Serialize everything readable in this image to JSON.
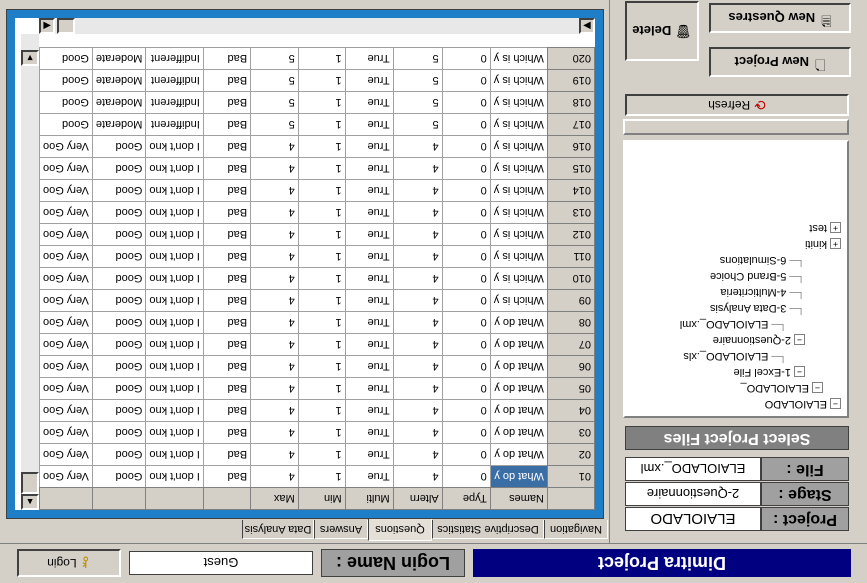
{
  "app_title": "Dimitra Project",
  "login": {
    "label": "Login Name :",
    "value": "Guest",
    "button": "Login"
  },
  "project_info": [
    {
      "label": "Project :",
      "value": "ELAIOLADO"
    },
    {
      "label": "Stage :",
      "value": "2-Questionnaire"
    },
    {
      "label": "File :",
      "value": "ELAIOLADO_.xml"
    }
  ],
  "toolbar": {
    "new_questres": "New Questres",
    "new_project": "New Project",
    "delete": "Delete",
    "refresh": "Refresh"
  },
  "select_files": "Select Project Files",
  "tree": [
    {
      "label": "ELAIOLADO",
      "toggle": "−",
      "level": 0
    },
    {
      "label": "ELAIOLADO_",
      "toggle": "−",
      "level": 1
    },
    {
      "label": "1-Excel File",
      "toggle": "−",
      "level": 2
    },
    {
      "label": "ELAIOLADO_.xls",
      "toggle": "",
      "level": 3
    },
    {
      "label": "2-Questionnaire",
      "toggle": "−",
      "level": 2
    },
    {
      "label": "ELAIOLADO_.xml",
      "toggle": "",
      "level": 3
    },
    {
      "label": "3-Data Analysis",
      "toggle": "",
      "level": 2
    },
    {
      "label": "4-Multicriteria",
      "toggle": "",
      "level": 2
    },
    {
      "label": "5-Brand Choice",
      "toggle": "",
      "level": 2
    },
    {
      "label": "6-Simulations",
      "toggle": "",
      "level": 2
    },
    {
      "label": "kiniti",
      "toggle": "+",
      "level": 0
    },
    {
      "label": "test",
      "toggle": "+",
      "level": 0
    }
  ],
  "tabs": [
    "Navigation",
    "Descriptive Statistics",
    "Questions",
    "Answers",
    "Data Analysis"
  ],
  "grid": {
    "columns": [
      "Names",
      "Type",
      "Altern",
      "Multi",
      "Min",
      "Max",
      "",
      "",
      "",
      ""
    ],
    "rows": [
      [
        "01",
        "What do y",
        "0",
        "4",
        "True",
        "1",
        "4",
        "Bad",
        "I don't kno",
        "Good",
        "Very Goo"
      ],
      [
        "02",
        "What do y",
        "0",
        "4",
        "True",
        "1",
        "4",
        "Bad",
        "I don't kno",
        "Good",
        "Very Goo"
      ],
      [
        "03",
        "What do y",
        "0",
        "4",
        "True",
        "1",
        "4",
        "Bad",
        "I don't kno",
        "Good",
        "Very Goo"
      ],
      [
        "04",
        "What do y",
        "0",
        "4",
        "True",
        "1",
        "4",
        "Bad",
        "I don't kno",
        "Good",
        "Very Goo"
      ],
      [
        "05",
        "What do y",
        "0",
        "4",
        "True",
        "1",
        "4",
        "Bad",
        "I don't kno",
        "Good",
        "Very Goo"
      ],
      [
        "06",
        "What do y",
        "0",
        "4",
        "True",
        "1",
        "4",
        "Bad",
        "I don't kno",
        "Good",
        "Very Goo"
      ],
      [
        "07",
        "What do y",
        "0",
        "4",
        "True",
        "1",
        "4",
        "Bad",
        "I don't kno",
        "Good",
        "Very Goo"
      ],
      [
        "08",
        "What do y",
        "0",
        "4",
        "True",
        "1",
        "4",
        "Bad",
        "I don't kno",
        "Good",
        "Very Goo"
      ],
      [
        "09",
        "Which is y",
        "0",
        "4",
        "True",
        "1",
        "4",
        "Bad",
        "I don't kno",
        "Good",
        "Very Goo"
      ],
      [
        "010",
        "Which is y",
        "0",
        "4",
        "True",
        "1",
        "4",
        "Bad",
        "I don't kno",
        "Good",
        "Very Goo"
      ],
      [
        "011",
        "Which is y",
        "0",
        "4",
        "True",
        "1",
        "4",
        "Bad",
        "I don't kno",
        "Good",
        "Very Goo"
      ],
      [
        "012",
        "Which is y",
        "0",
        "4",
        "True",
        "1",
        "4",
        "Bad",
        "I don't kno",
        "Good",
        "Very Goo"
      ],
      [
        "013",
        "Which is y",
        "0",
        "4",
        "True",
        "1",
        "4",
        "Bad",
        "I don't kno",
        "Good",
        "Very Goo"
      ],
      [
        "014",
        "Which is y",
        "0",
        "4",
        "True",
        "1",
        "4",
        "Bad",
        "I don't kno",
        "Good",
        "Very Goo"
      ],
      [
        "015",
        "Which is y",
        "0",
        "4",
        "True",
        "1",
        "4",
        "Bad",
        "I don't kno",
        "Good",
        "Very Goo"
      ],
      [
        "016",
        "Which is y",
        "0",
        "4",
        "True",
        "1",
        "4",
        "Bad",
        "I don't kno",
        "Good",
        "Very Goo"
      ],
      [
        "017",
        "Which is y",
        "0",
        "5",
        "True",
        "1",
        "5",
        "Bad",
        "Indifferent",
        "Moderate",
        "Good"
      ],
      [
        "018",
        "Which is y",
        "0",
        "5",
        "True",
        "1",
        "5",
        "Bad",
        "Indifferent",
        "Moderate",
        "Good"
      ],
      [
        "019",
        "Which is y",
        "0",
        "5",
        "True",
        "1",
        "5",
        "Bad",
        "Indifferent",
        "Moderate",
        "Good"
      ],
      [
        "020",
        "Which is y",
        "0",
        "5",
        "True",
        "1",
        "5",
        "Bad",
        "Indifferent",
        "Moderate",
        "Good"
      ]
    ]
  },
  "colors": {
    "title_bg": "#000080",
    "grid_frame": "#1e7fc8",
    "selected_cell": "#3a6ea5"
  }
}
